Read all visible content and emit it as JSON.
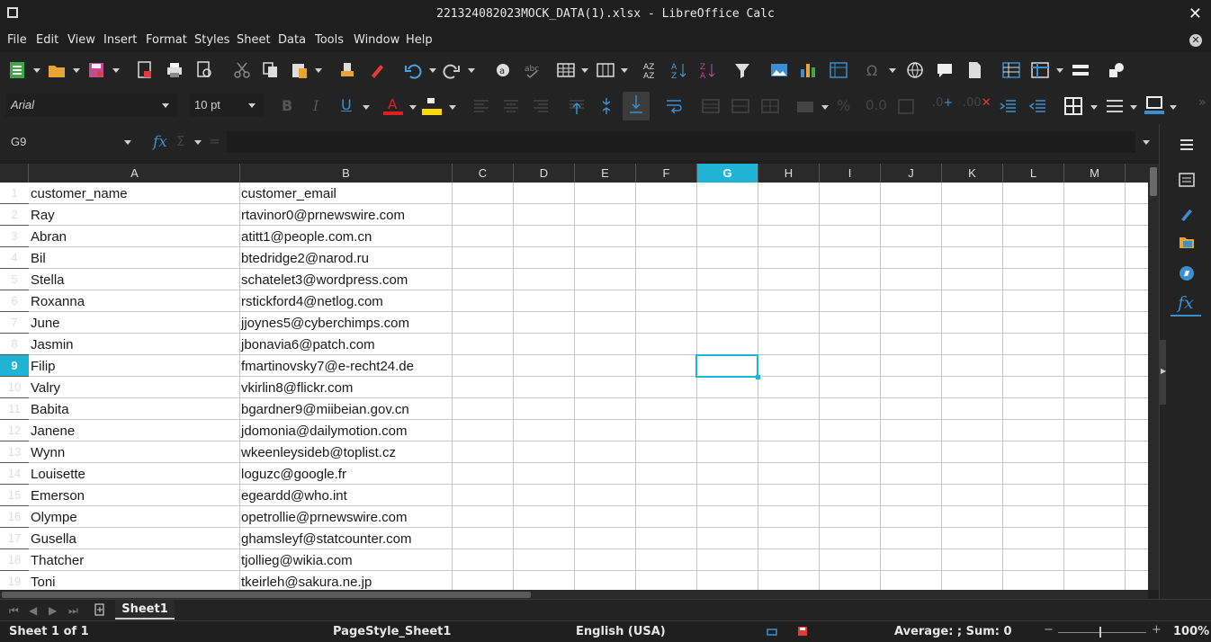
{
  "window": {
    "title": "22132408202 3MOCK_DATA(1).xlsx - LibreOffice Calc"
  },
  "menu": [
    "File",
    "Edit",
    "View",
    "Insert",
    "Format",
    "Styles",
    "Sheet",
    "Data",
    "Tools",
    "Window",
    "Help"
  ],
  "toolbar": {
    "font_name": "Arial",
    "font_size": "10 pt",
    "accent": "#1fb4d6",
    "font_color": "#e02020",
    "highlight_color": "#ffd800"
  },
  "formula_bar": {
    "name_box": "G9",
    "fx_label": "fx",
    "sigma_label": "Σ",
    "equals_label": "=",
    "content": ""
  },
  "sheet": {
    "columns": [
      "A",
      "B",
      "C",
      "D",
      "E",
      "F",
      "G",
      "H",
      "I",
      "J",
      "K",
      "L",
      "M"
    ],
    "active_column": "G",
    "active_row": "9",
    "rows": [
      {
        "n": "1",
        "a": "customer_name",
        "b": "customer_email"
      },
      {
        "n": "2",
        "a": "Ray",
        "b": "rtavinor0@prnewswire.com"
      },
      {
        "n": "3",
        "a": "Abran",
        "b": "atitt1@people.com.cn"
      },
      {
        "n": "4",
        "a": "Bil",
        "b": "btedridge2@narod.ru"
      },
      {
        "n": "5",
        "a": "Stella",
        "b": "schatelet3@wordpress.com"
      },
      {
        "n": "6",
        "a": "Roxanna",
        "b": "rstickford4@netlog.com"
      },
      {
        "n": "7",
        "a": "June",
        "b": "jjoynes5@cyberchimps.com"
      },
      {
        "n": "8",
        "a": "Jasmin",
        "b": "jbonavia6@patch.com"
      },
      {
        "n": "9",
        "a": "Filip",
        "b": "fmartinovsky7@e-recht24.de"
      },
      {
        "n": "10",
        "a": "Valry",
        "b": "vkirlin8@flickr.com"
      },
      {
        "n": "11",
        "a": "Babita",
        "b": "bgardner9@miibeian.gov.cn"
      },
      {
        "n": "12",
        "a": "Janene",
        "b": "jdomonia@dailymotion.com"
      },
      {
        "n": "13",
        "a": "Wynn",
        "b": "wkeenleysideb@toplist.cz"
      },
      {
        "n": "14",
        "a": "Louisette",
        "b": "loguzc@google.fr"
      },
      {
        "n": "15",
        "a": "Emerson",
        "b": "egeardd@who.int"
      },
      {
        "n": "16",
        "a": "Olympe",
        "b": "opetrollie@prnewswire.com"
      },
      {
        "n": "17",
        "a": "Gusella",
        "b": "ghamsleyf@statcounter.com"
      },
      {
        "n": "18",
        "a": "Thatcher",
        "b": "tjollieg@wikia.com"
      },
      {
        "n": "19",
        "a": "Toni",
        "b": "tkeirleh@sakura.ne.jp"
      }
    ]
  },
  "tabs": {
    "sheet1": "Sheet1"
  },
  "status": {
    "sheet_of": "Sheet 1 of 1",
    "page_style": "PageStyle_Sheet1",
    "language": "English (USA)",
    "summary": "Average: ; Sum: 0",
    "zoom": "100%"
  }
}
